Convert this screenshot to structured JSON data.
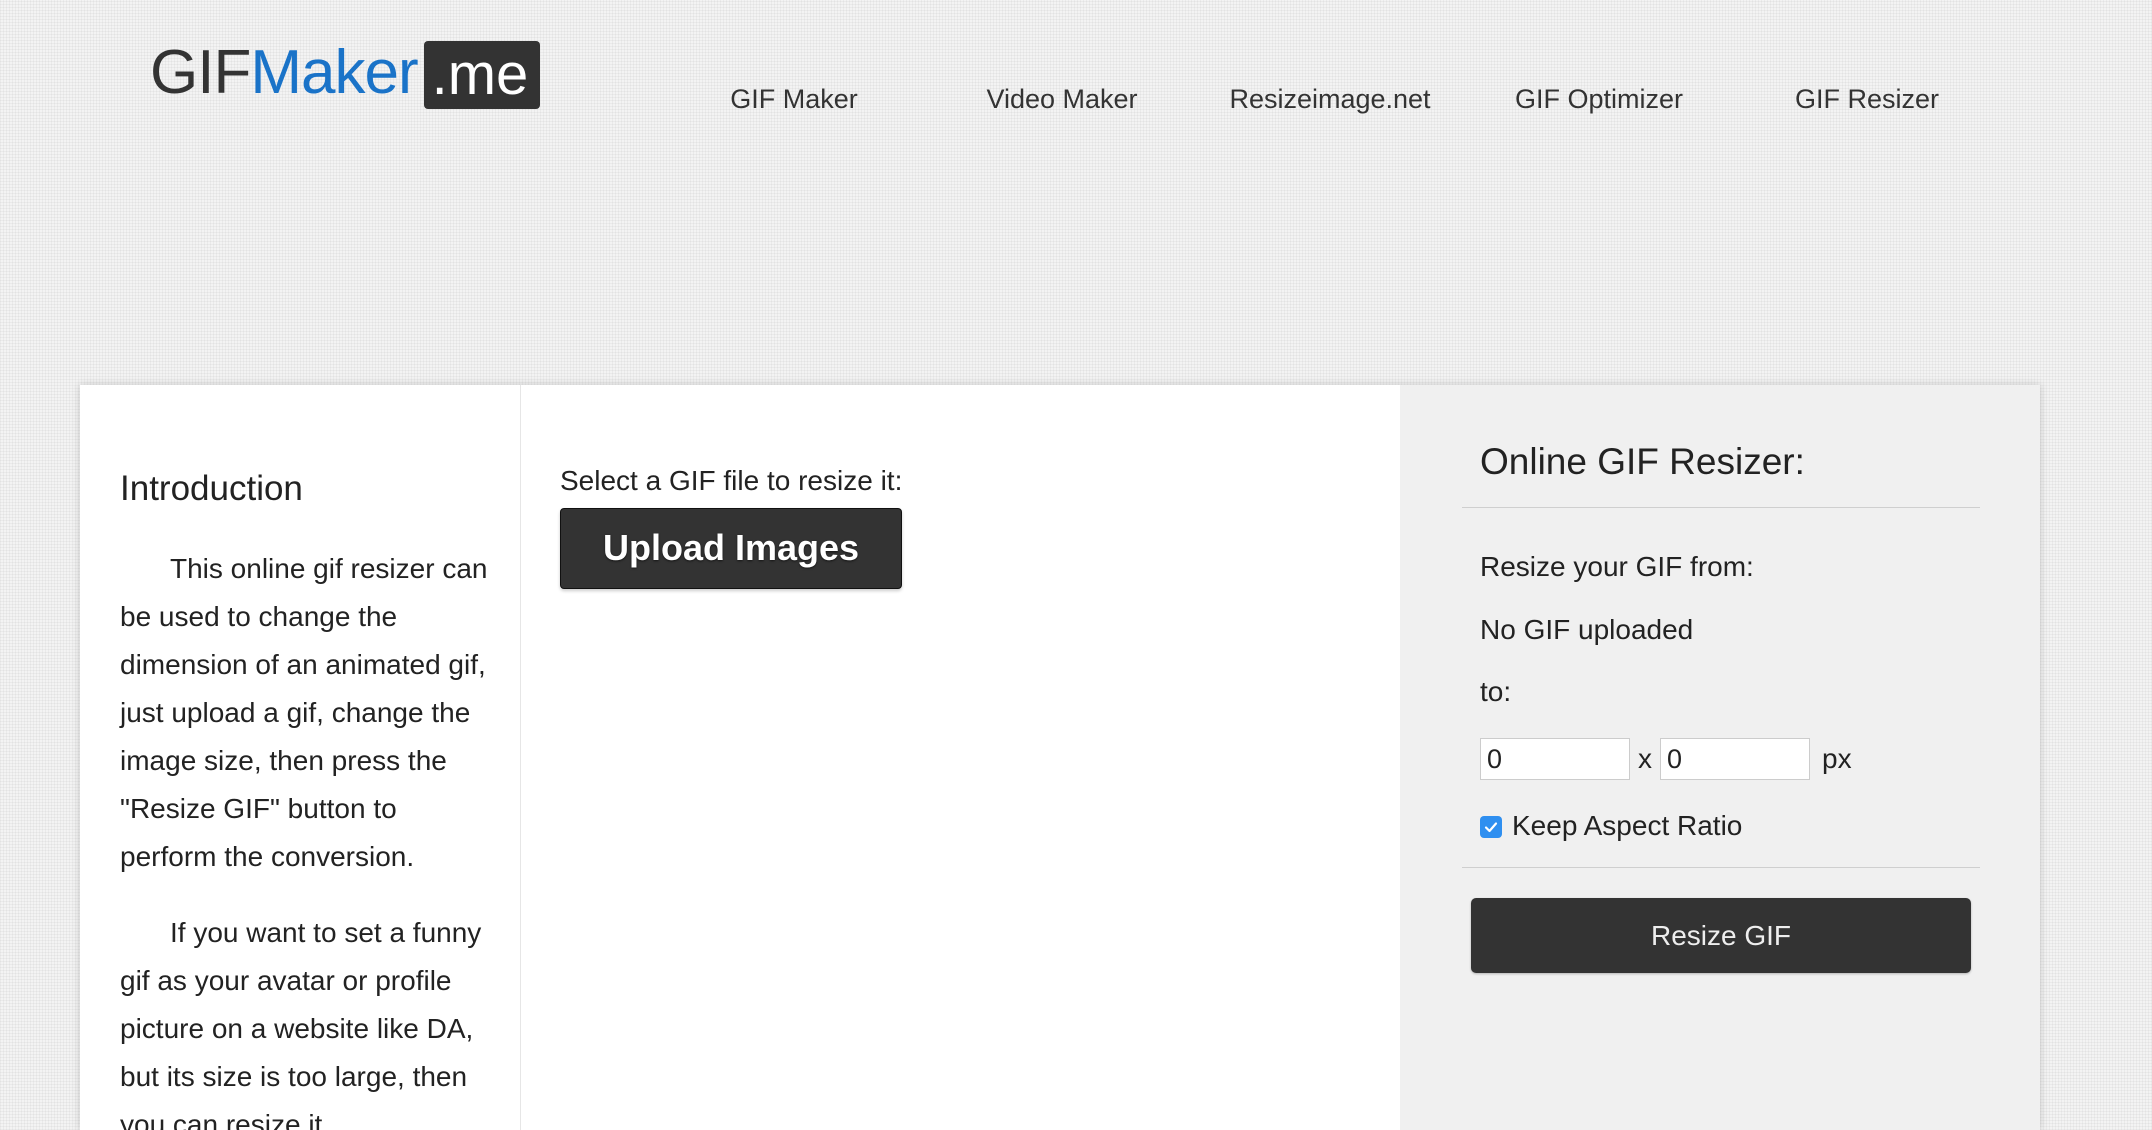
{
  "header": {
    "logo": {
      "part1": "GIF",
      "part2": "Maker",
      "part3": ".me"
    },
    "nav": [
      {
        "label": "GIF Maker"
      },
      {
        "label": "Video Maker"
      },
      {
        "label": "Resizeimage.net"
      },
      {
        "label": "GIF Optimizer"
      },
      {
        "label": "GIF Resizer"
      }
    ]
  },
  "intro": {
    "heading": "Introduction",
    "paragraphs": [
      "This online gif resizer can be used to change the dimension of an animated gif, just upload a gif, change the image size, then press the \"Resize GIF\" button to perform the conversion.",
      "If you want to set a funny gif as your avatar or profile picture on a website like DA, but its size is too large, then you can resize it"
    ]
  },
  "upload": {
    "label": "Select a GIF file to resize it:",
    "button_label": "Upload Images"
  },
  "resizer": {
    "title": "Online GIF Resizer:",
    "from_label": "Resize your GIF from:",
    "status": "No GIF uploaded",
    "to_label": "to:",
    "width_value": "0",
    "height_value": "0",
    "separator": "x",
    "unit": "px",
    "keep_aspect_label": "Keep Aspect Ratio",
    "keep_aspect_checked": true,
    "button_label": "Resize GIF"
  },
  "colors": {
    "brand_blue": "#1a73c8",
    "dark_button": "#333333",
    "checkbox_blue": "#2f8ff0",
    "sidebar_bg": "#f0f0f0"
  }
}
